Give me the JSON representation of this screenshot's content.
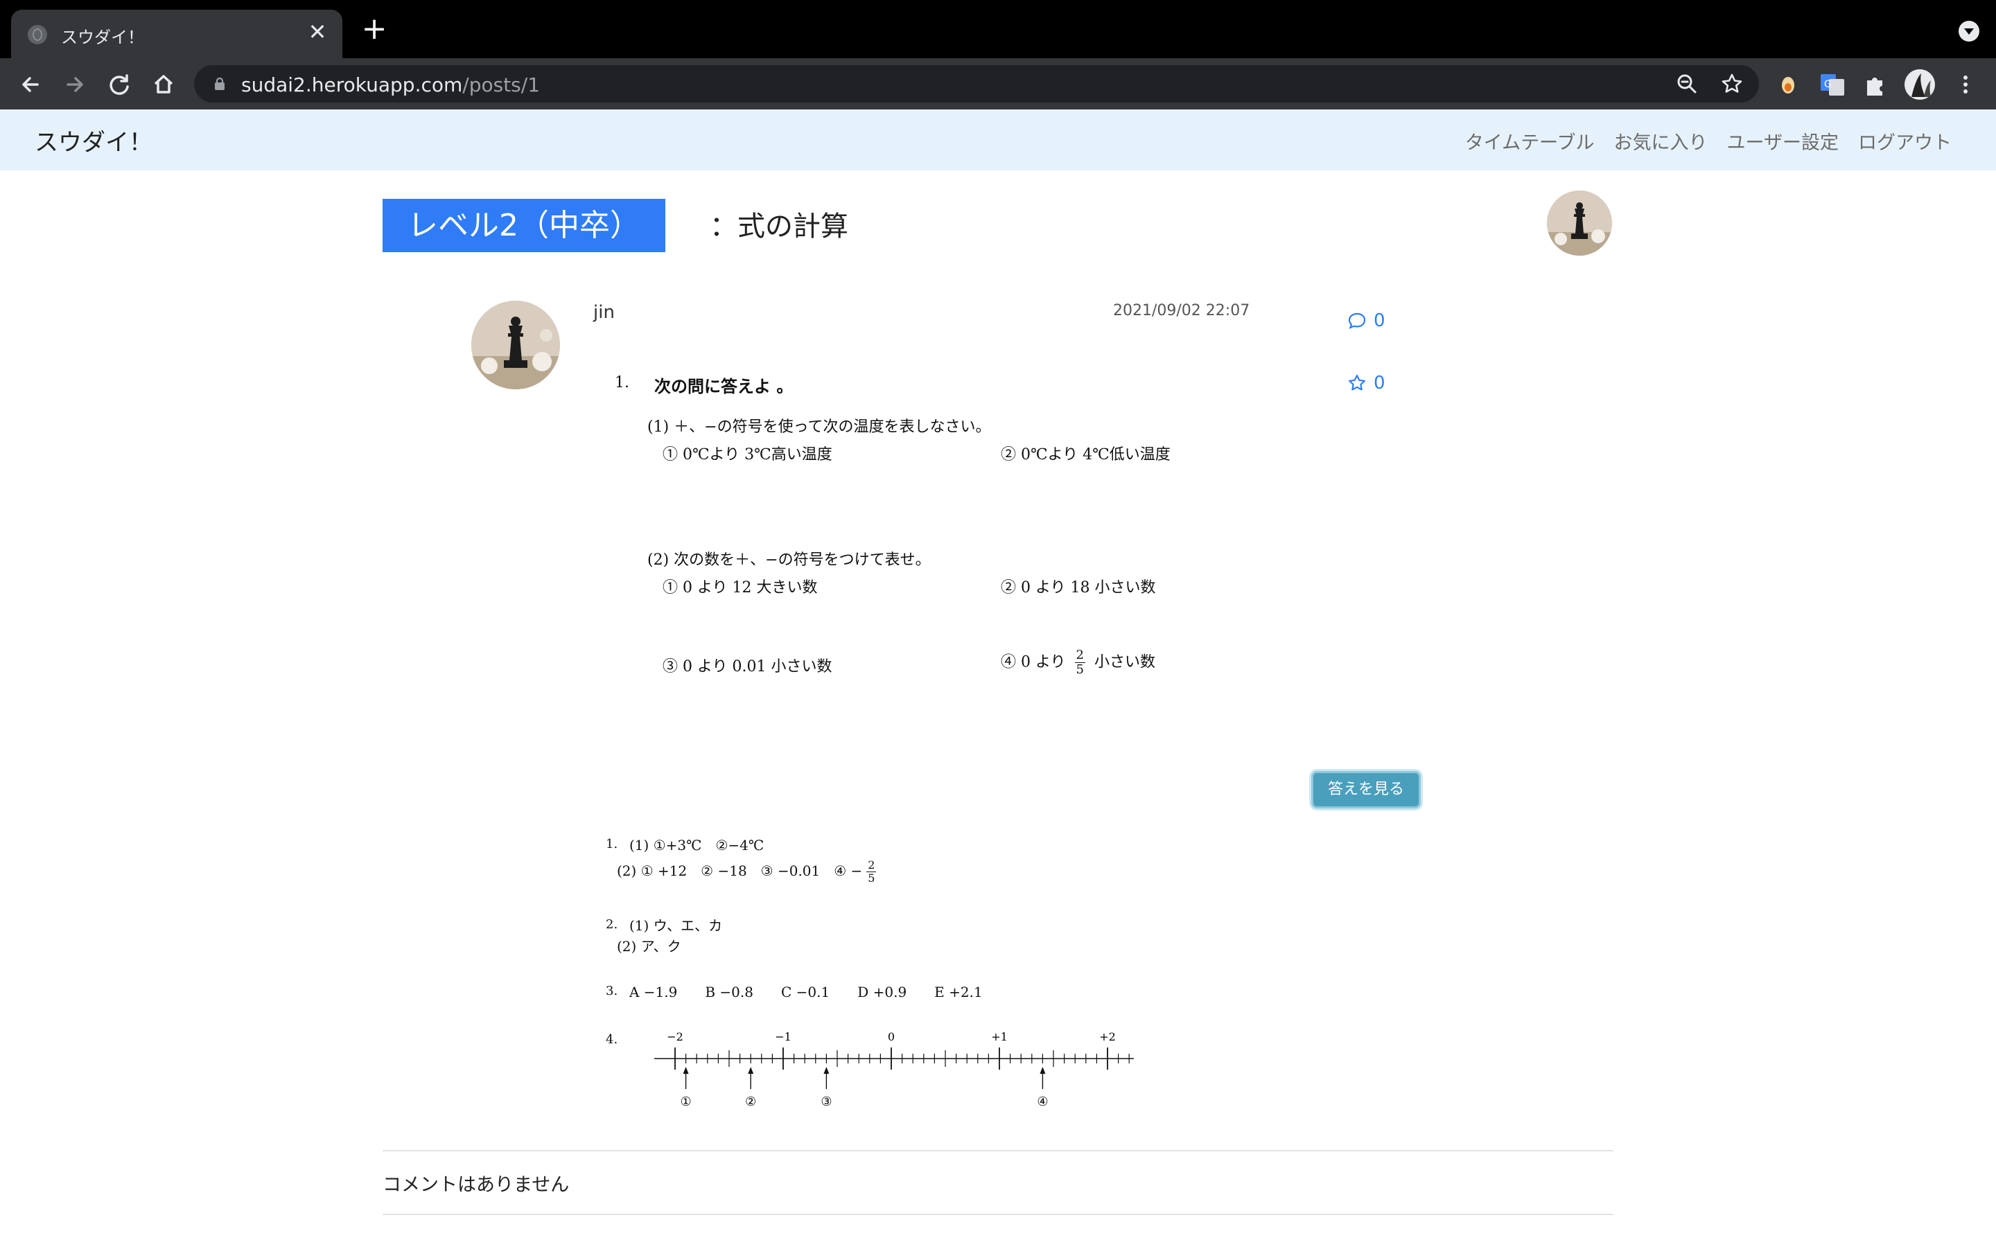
{
  "browser": {
    "tab_title": "スウダイ！",
    "close_glyph": "✕",
    "new_tab_glyph": "+",
    "url_host": "sudai2.herokuapp.com",
    "url_path": "/posts/1"
  },
  "site": {
    "brand": "スウダイ！",
    "nav": [
      "タイムテーブル",
      "お気に入り",
      "ユーザー設定",
      "ログアウト"
    ]
  },
  "post": {
    "level": "レベル2（中卒）",
    "topic": "：式の計算",
    "author": "jin",
    "timestamp": "2021/09/02 22:07",
    "comment_count": "0",
    "favorite_count": "0",
    "question": {
      "number": "1.",
      "heading": "次の問に答えよ 。",
      "part1": "(1) ＋、−の符号を使って次の温度を表しなさい。",
      "part1_a": "① 0℃より 3℃高い温度",
      "part1_b": "② 0℃より 4℃低い温度",
      "part2": "(2) 次の数を＋、−の符号をつけて表せ。",
      "part2_a": "① 0 より 12 大きい数",
      "part2_b": "② 0 より 18 小さい数",
      "part2_c": "③ 0 より 0.01 小さい数",
      "part2_d_pre": "④ 0 より",
      "part2_d_num": "2",
      "part2_d_den": "5",
      "part2_d_post": "小さい数"
    },
    "answer_button": "答えを見る",
    "answers": {
      "a1_num": "1.",
      "a1_line1": "(1) ①+3℃　②−4℃",
      "a1_line2": "(2) ① +12　② −18　③ −0.01　④ −",
      "a1_num_frac": "2",
      "a1_den_frac": "5",
      "a2_num": "2.",
      "a2_line1": "(1) ウ、エ、カ",
      "a2_line2": "(2) ア、ク",
      "a3_num": "3.",
      "a3_line": "A −1.9　　B −0.8　　C −0.1　　D +0.9　　E +2.1",
      "a4_num": "4.",
      "numberline_labels": [
        "−2",
        "−1",
        "0",
        "+1",
        "+2"
      ],
      "arrow_labels": [
        "①",
        "②",
        "③",
        "④"
      ]
    },
    "no_comments": "コメントはありません"
  }
}
